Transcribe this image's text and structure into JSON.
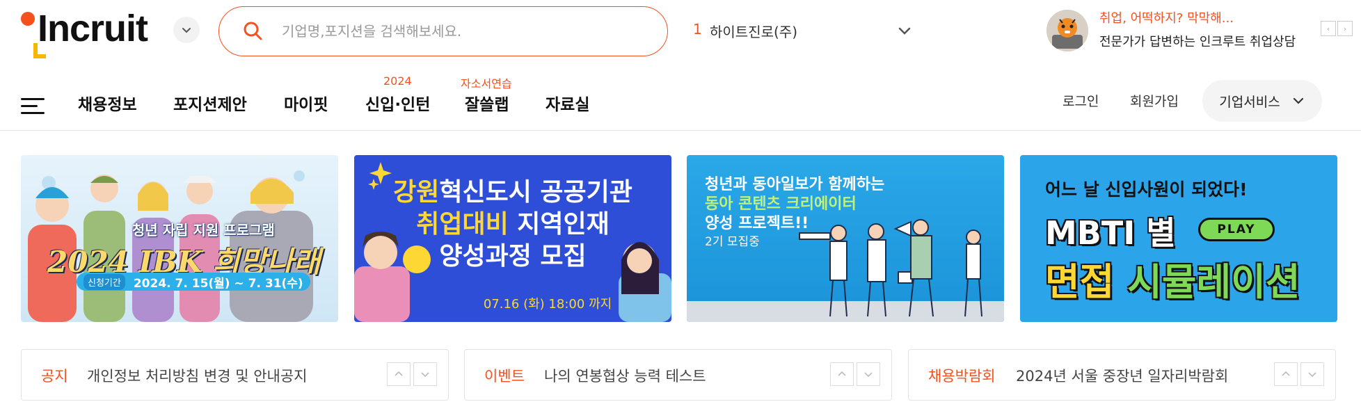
{
  "brand": {
    "logo_text": "Incruit"
  },
  "search": {
    "placeholder": "기업명,포지션을 검색해보세요."
  },
  "ranking": {
    "number": "1",
    "company": "하이트진로(주)"
  },
  "promo": {
    "title": "취업, 어떡하지? 막막해...",
    "subtitle": "전문가가 답변하는 인크루트 취업상담"
  },
  "nav": {
    "items": [
      {
        "label": "채용정보",
        "sup": ""
      },
      {
        "label": "포지션제안",
        "sup": ""
      },
      {
        "label": "마이핏",
        "sup": ""
      },
      {
        "label": "신입·인턴",
        "sup": "2024"
      },
      {
        "label": "잘쓸랩",
        "sup": "자소서연습"
      },
      {
        "label": "자료실",
        "sup": ""
      }
    ],
    "login": "로그인",
    "signup": "회원가입",
    "business": "기업서비스"
  },
  "banners": [
    {
      "title": "청년 자립 지원 프로그램",
      "main": "2024 IBK 희망나래",
      "period_label": "신청기간",
      "period": "2024. 7. 15(월) ~ 7. 31(수)"
    },
    {
      "line1_highlight": "강원",
      "line1_rest": "혁신도시 공공기관",
      "line2_highlight": "취업대비",
      "line2_rest": " 지역인재",
      "line3": "양성과정 모집",
      "date": "07.16 (화) 18:00 까지"
    },
    {
      "line1": "청년과 동아일보가 함께하는",
      "line2": "동아 콘텐츠 크리에이터",
      "line3": "양성 프로젝트!!",
      "small": "2기 모집중"
    },
    {
      "top": "어느 날 신입사원이 되었다!",
      "mbti": "MBTI 별",
      "play": "PLAY",
      "bottom_a": "면접 ",
      "bottom_b": "시뮬레이션"
    }
  ],
  "notices": [
    {
      "category": "공지",
      "text": "개인정보 처리방침 변경 및 안내공지"
    },
    {
      "category": "이벤트",
      "text": "나의 연봉협상 능력 테스트"
    },
    {
      "category": "채용박람회",
      "text": "2024년 서울 중장년 일자리박람회"
    }
  ],
  "colors": {
    "accent": "#f4511e",
    "blue_banner": "#2f4ed8",
    "sky_banner": "#2ba4ea"
  }
}
